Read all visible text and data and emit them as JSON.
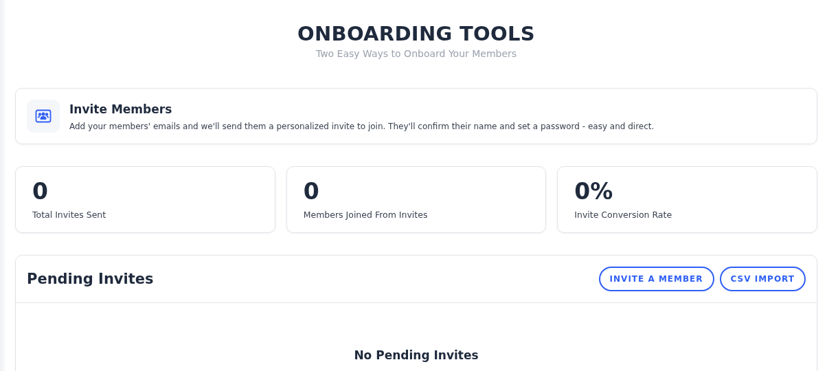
{
  "header": {
    "title": "ONBOARDING TOOLS",
    "subtitle": "Two Easy Ways to Onboard Your Members"
  },
  "invite_card": {
    "title": "Invite Members",
    "description": "Add your members' emails and we'll send them a personalized invite to join. They'll confirm their name and set a password - easy and direct."
  },
  "stats": [
    {
      "value": "0",
      "label": "Total Invites Sent"
    },
    {
      "value": "0",
      "label": "Members Joined From Invites"
    },
    {
      "value": "0%",
      "label": "Invite Conversion Rate"
    }
  ],
  "pending": {
    "title": "Pending Invites",
    "buttons": [
      "INVITE A MEMBER",
      "CSV IMPORT"
    ],
    "empty_title": "No Pending Invites"
  }
}
